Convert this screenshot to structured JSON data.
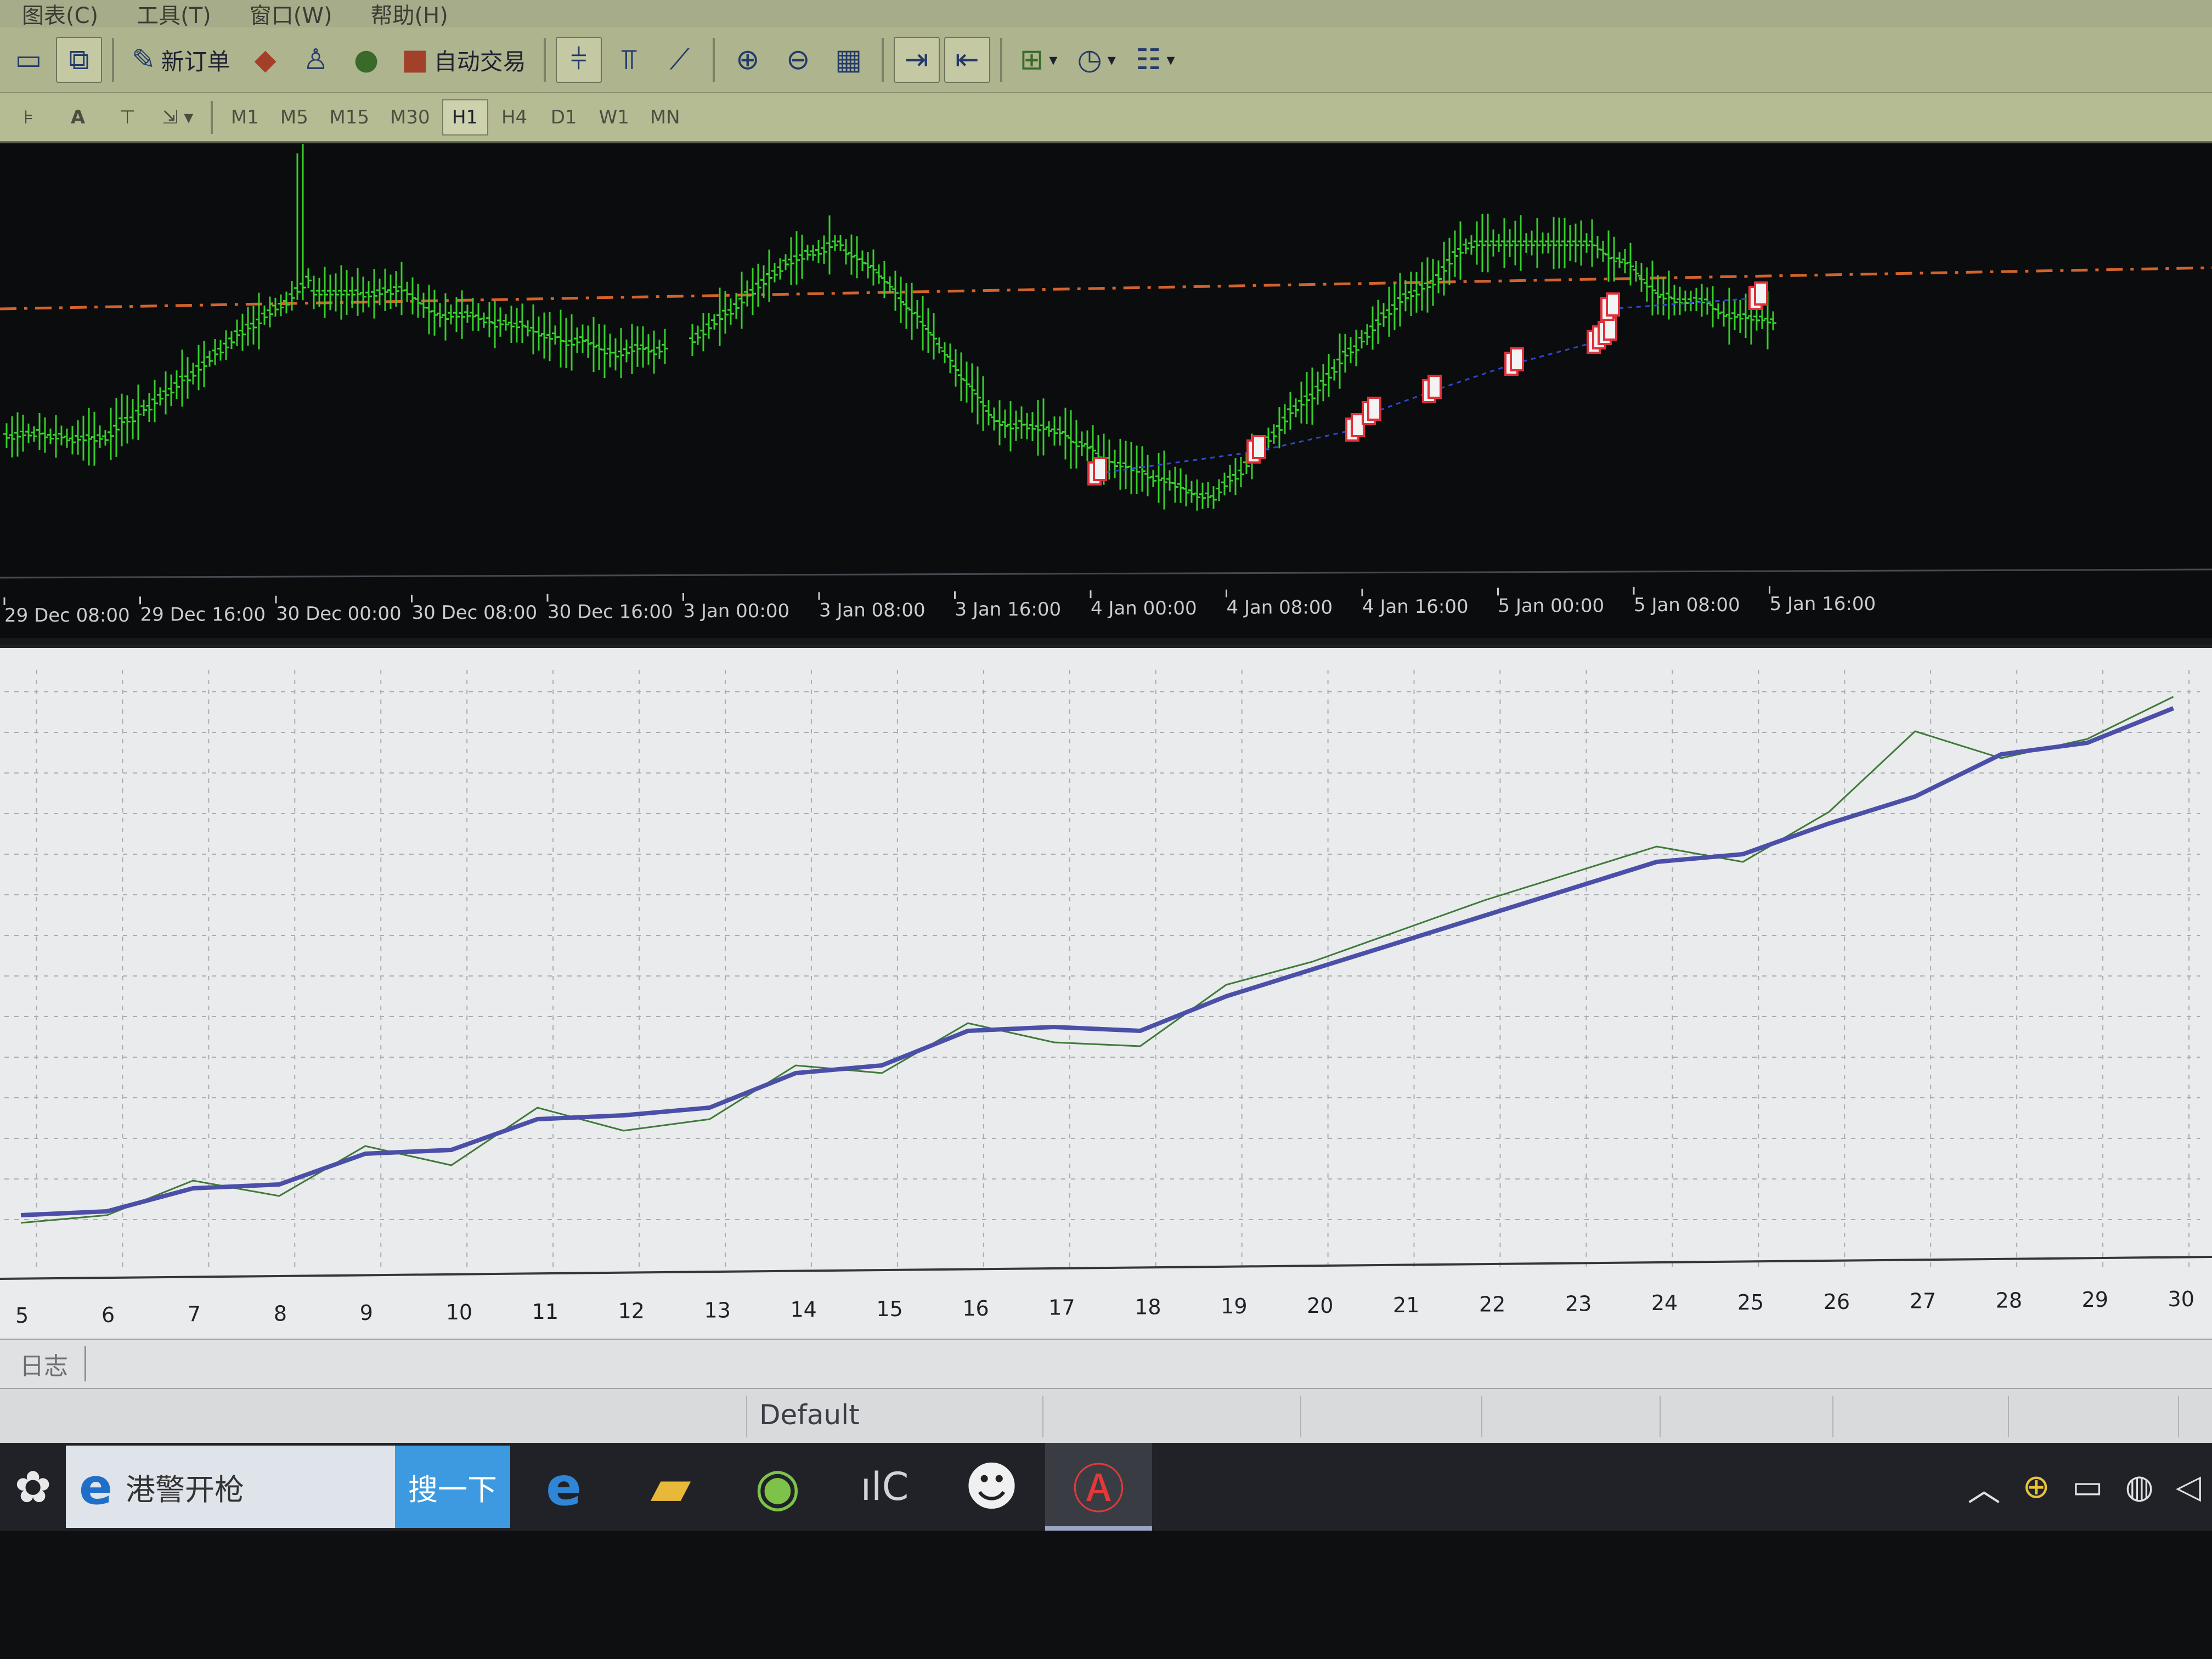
{
  "menu": [
    "图表(C)",
    "工具(T)",
    "窗口(W)",
    "帮助(H)"
  ],
  "toolbar": {
    "new_order_label": "新订单",
    "auto_trading_label": "自动交易",
    "timeframes": [
      "M1",
      "M5",
      "M15",
      "M30",
      "H1",
      "H4",
      "D1",
      "W1",
      "MN"
    ],
    "active_timeframe": "H1"
  },
  "chart": {
    "x_labels": [
      "29 Dec 08:00",
      "29 Dec 16:00",
      "30 Dec 00:00",
      "30 Dec 08:00",
      "30 Dec 16:00",
      "3 Jan 00:00",
      "3 Jan 08:00",
      "3 Jan 16:00",
      "4 Jan 00:00",
      "4 Jan 08:00",
      "4 Jan 16:00",
      "5 Jan 00:00",
      "5 Jan 08:00",
      "5 Jan 16:00"
    ],
    "colors": {
      "background": "#0b0c0d",
      "bars": "#35d12a",
      "price_line": "#d2632e",
      "trade_line": "#2f47c9",
      "trade_marker": "#e0303a"
    }
  },
  "graph": {
    "x_labels": [
      "5",
      "6",
      "7",
      "8",
      "9",
      "10",
      "11",
      "12",
      "13",
      "14",
      "15",
      "16",
      "17",
      "18",
      "19",
      "20",
      "21",
      "22",
      "23",
      "24",
      "25",
      "26",
      "27",
      "28",
      "29",
      "30"
    ],
    "balance": [
      0.08,
      0.09,
      0.15,
      0.16,
      0.24,
      0.25,
      0.33,
      0.34,
      0.36,
      0.45,
      0.47,
      0.56,
      0.57,
      0.56,
      0.65,
      0.72,
      0.79,
      0.86,
      0.93,
      1.0,
      1.02,
      1.1,
      1.17,
      1.28,
      1.31,
      1.4
    ],
    "equity": [
      0.06,
      0.08,
      0.17,
      0.13,
      0.26,
      0.21,
      0.36,
      0.3,
      0.33,
      0.47,
      0.45,
      0.58,
      0.53,
      0.52,
      0.68,
      0.74,
      0.82,
      0.9,
      0.97,
      1.04,
      1.0,
      1.13,
      1.34,
      1.27,
      1.32,
      1.43
    ],
    "colors": {
      "balance": "#4b4fa8",
      "equity": "#3f7a3a",
      "grid": "#a9adb2"
    }
  },
  "journal": {
    "tab_label": "日志"
  },
  "status": {
    "profile": "Default"
  },
  "taskbar": {
    "search_text": "港警开枪",
    "search_button": "搜一下"
  }
}
